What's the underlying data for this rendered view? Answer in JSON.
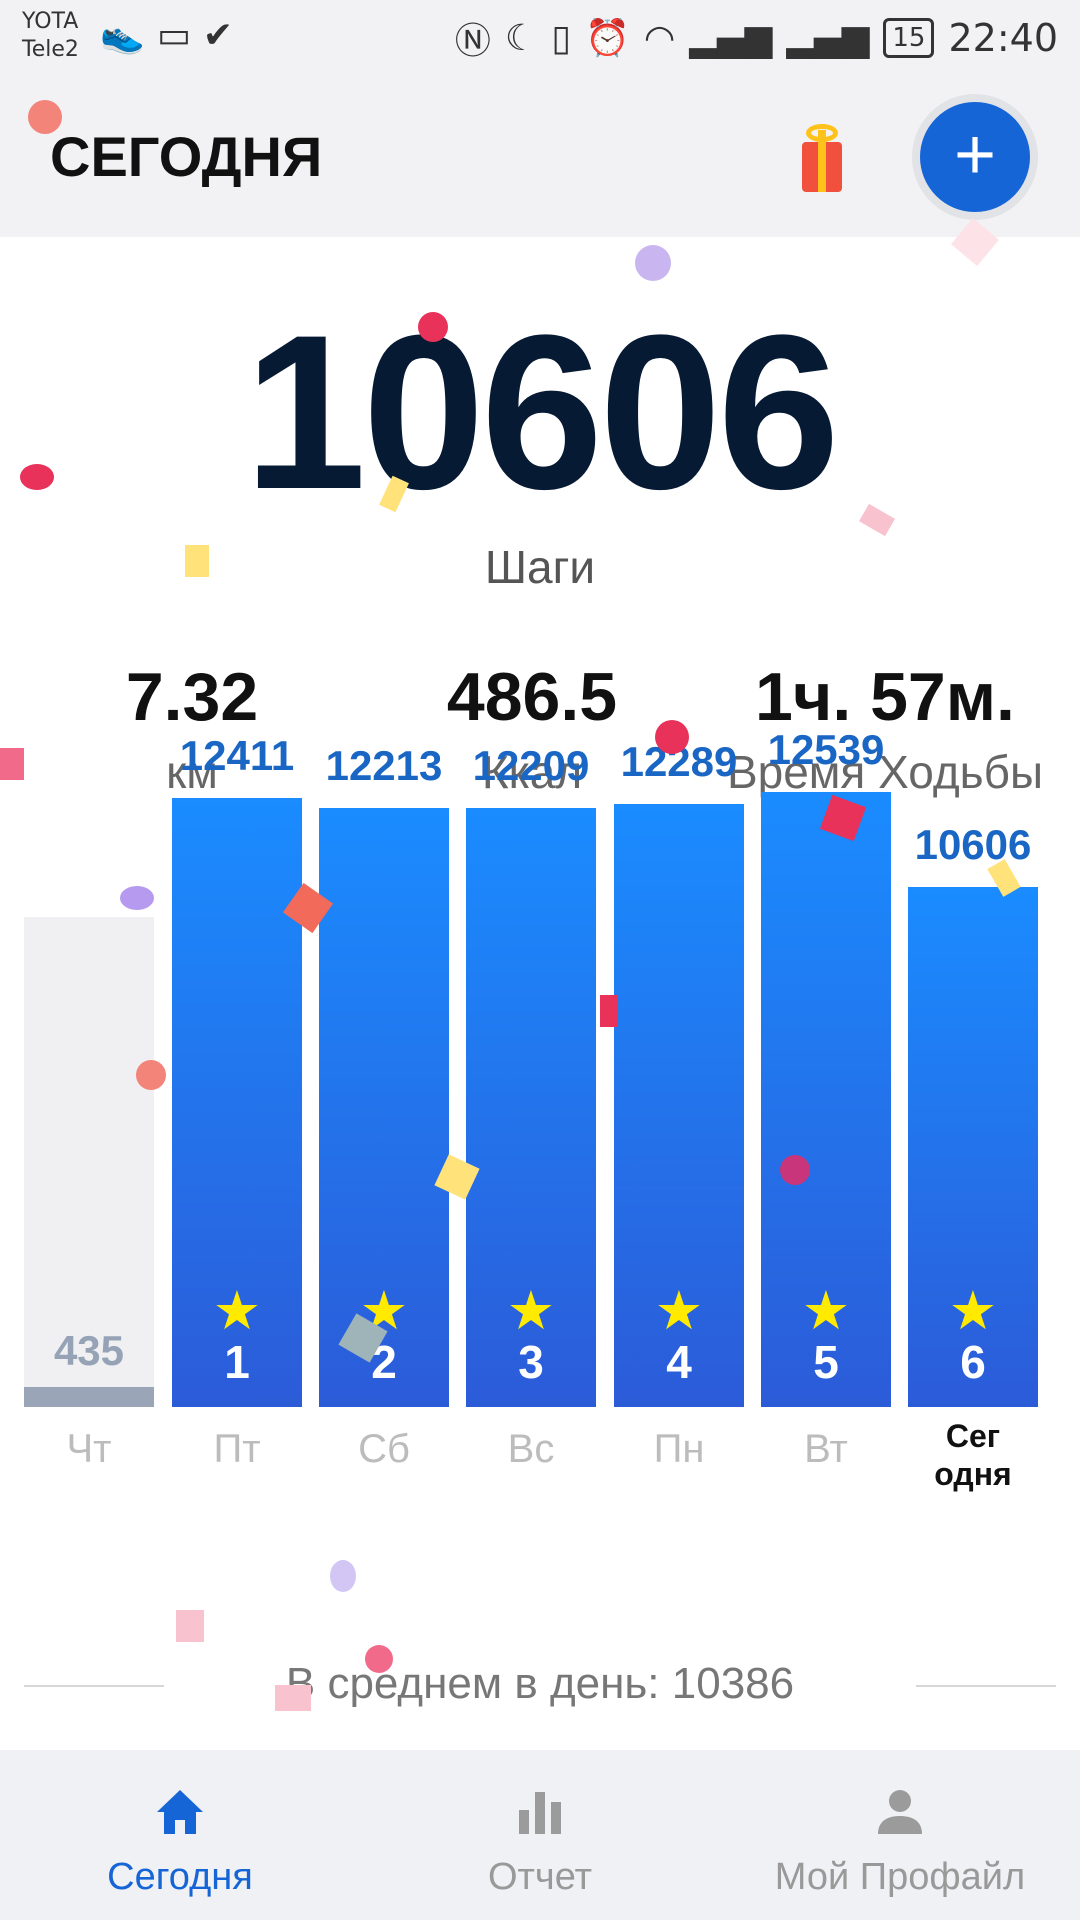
{
  "status_bar": {
    "carrier_1": "YOTA",
    "carrier_2": "Tele2",
    "battery": "15",
    "time": "22:40"
  },
  "header": {
    "title": "СЕГОДНЯ",
    "gift_icon": "gift-icon",
    "add_icon": "plus-icon"
  },
  "summary": {
    "steps": "10606",
    "steps_label": "Шаги",
    "distance_value": "7.32",
    "distance_label": "км",
    "calories_value": "486.5",
    "calories_label": "Ккал",
    "time_value": "1ч. 57м.",
    "time_label": "Время Ходьбы"
  },
  "chart_data": {
    "type": "bar",
    "categories": [
      "Чт",
      "Пт",
      "Сб",
      "Вс",
      "Пн",
      "Вт",
      "Сегодня"
    ],
    "values": [
      435,
      12411,
      12213,
      12209,
      12289,
      12539,
      10606
    ],
    "value_labels": [
      "435",
      "12411",
      "12213",
      "12209",
      "12289",
      "12539",
      "10606"
    ],
    "ranks": [
      "",
      "1",
      "2",
      "3",
      "4",
      "5",
      "6"
    ],
    "day_labels": [
      "Чт",
      "Пт",
      "Сб",
      "Вс",
      "Пн",
      "Вт",
      "Сег\nодня"
    ],
    "colors": {
      "active": "#1a8cff",
      "inactive": "#f0f0f2",
      "star": "#ffea00"
    }
  },
  "average": {
    "text": "В среднем в день: 10386"
  },
  "tabs": [
    {
      "label": "Сегодня",
      "icon": "home-icon",
      "active": true
    },
    {
      "label": "Отчет",
      "icon": "bar-chart-icon",
      "active": false
    },
    {
      "label": "Мой Профайл",
      "icon": "profile-icon",
      "active": false
    }
  ],
  "colors": {
    "accent": "#1565d6",
    "steps_text": "#071a33"
  }
}
